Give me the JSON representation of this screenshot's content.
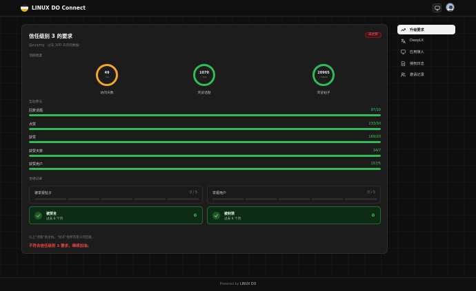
{
  "header": {
    "brand": "LINUX DO Connect",
    "logo_icon": "linuxdo-logo-icon",
    "monitor_icon": "monitor-icon",
    "avatar_icon": "user-avatar"
  },
  "card": {
    "title": "信任级别 3 的要求",
    "status_badge": "未达到",
    "subtitle": "@zuiymg · 过去 100 天内的数据",
    "activity_label": "活跃程度",
    "rings": [
      {
        "value": "49",
        "requirement": "/ 50",
        "caption": "访问天数",
        "progress": 0.98,
        "color": "#f5a623"
      },
      {
        "value": "1070",
        "requirement": "/ 500",
        "caption": "浏览话题",
        "progress": 1.0,
        "color": "#2ebd57"
      },
      {
        "value": "20965",
        "requirement": "/ 20000",
        "caption": "浏览帖子",
        "progress": 1.0,
        "color": "#2ebd57"
      }
    ],
    "interaction_label": "互动参与",
    "bars": [
      {
        "label": "回复话题",
        "value": "97/10",
        "progress": 1.0
      },
      {
        "label": "点赞",
        "value": "233/30",
        "progress": 1.0
      },
      {
        "label": "获赞",
        "value": "169/20",
        "progress": 1.0
      },
      {
        "label": "获赞天数",
        "value": "34/7",
        "progress": 1.0
      },
      {
        "label": "获赞用户",
        "value": "157/5",
        "progress": 1.0
      }
    ],
    "compliance_label": "合规记录",
    "violations": [
      {
        "label": "被举报帖子",
        "count": "0 / 5"
      },
      {
        "label": "举报用户",
        "count": "0 / 5"
      }
    ],
    "penalties": [
      {
        "title": "被禁言",
        "sub": "过去 6 个月",
        "count": "0"
      },
      {
        "title": "被封禁",
        "sub": "过去 6 个月",
        "count": "0"
      }
    ],
    "note": "以上\"话题\"指主帖，\"帖子\"指所有意义的回复。",
    "warning": "不符合信任级别 3 要求，继续加油。"
  },
  "sidebar": {
    "items": [
      {
        "label": "升级要求",
        "icon": "trending-up-icon",
        "active": true
      },
      {
        "label": "DeepLX",
        "icon": "translate-icon",
        "active": false
      },
      {
        "label": "应用接入",
        "icon": "app-access-icon",
        "active": false
      },
      {
        "label": "授权日志",
        "icon": "log-file-icon",
        "active": false
      },
      {
        "label": "邀请记录",
        "icon": "users-icon",
        "active": false
      }
    ]
  },
  "footer": {
    "prefix": "Powered by",
    "brand": "LINUX DO"
  },
  "colors": {
    "accent_green": "#2ebd57",
    "accent_orange": "#f5a623",
    "danger": "#ef4444"
  }
}
